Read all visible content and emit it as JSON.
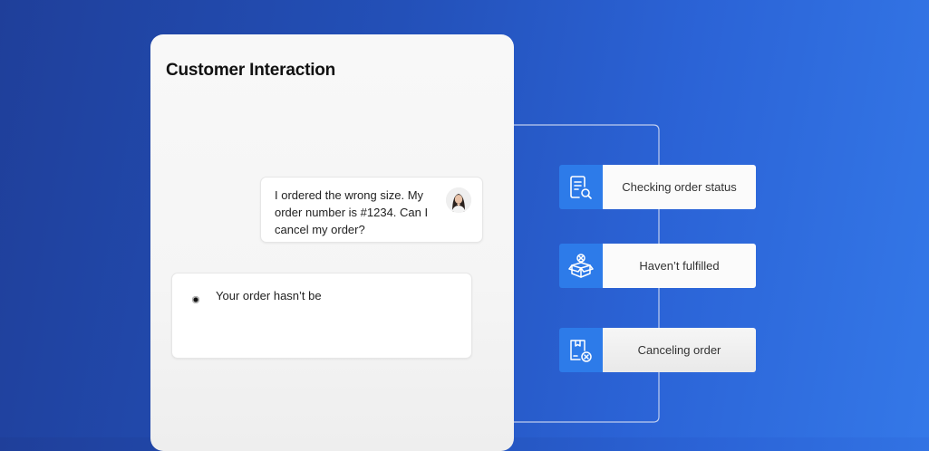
{
  "panel": {
    "title": "Customer Interaction"
  },
  "messages": {
    "user": "I ordered the wrong size. My order number is #1234. Can I cancel my order?",
    "agent": "Your order hasn’t be"
  },
  "steps": [
    {
      "label": "Checking order status",
      "icon": "document-search-icon"
    },
    {
      "label": "Haven’t fulfilled",
      "icon": "package-icon"
    },
    {
      "label": "Canceling order",
      "icon": "cancel-order-icon"
    }
  ],
  "colors": {
    "background_start": "#1f3f9a",
    "background_end": "#3478e8",
    "step_icon_bg": "#2d7be9",
    "panel_bg": "#f8f8f8"
  }
}
